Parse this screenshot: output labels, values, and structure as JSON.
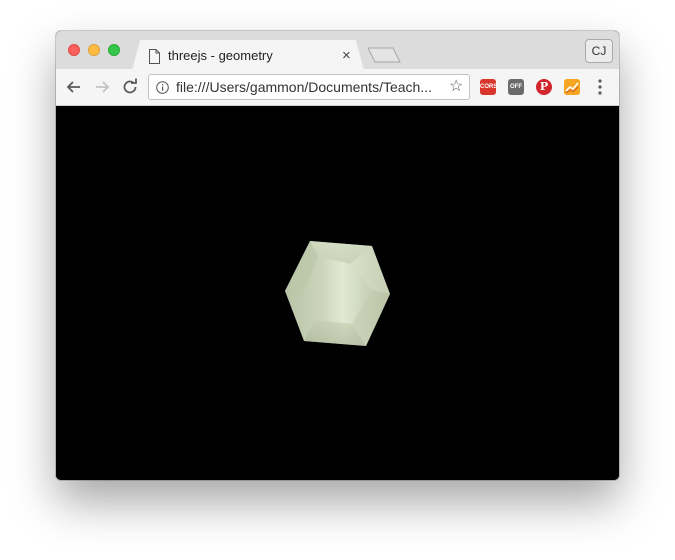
{
  "window": {
    "tab_title": "threejs - geometry",
    "tab_close_glyph": "×",
    "profile_label": "CJ"
  },
  "toolbar": {
    "url": "file:///Users/gammon/Documents/Teach...",
    "star_glyph": "☆",
    "extensions": [
      {
        "name": "cors-extension-icon",
        "label": "CORS"
      },
      {
        "name": "off-extension-icon",
        "label": "OFF"
      },
      {
        "name": "pinterest-extension-icon",
        "label": "P"
      },
      {
        "name": "analytics-extension-icon",
        "label": ""
      }
    ]
  },
  "scene": {
    "background": "#000000",
    "object": "hexagonal-prism-geometry",
    "object_color": "#d2dcc0"
  },
  "icons": {
    "back": "arrow-left-icon",
    "forward": "arrow-right-icon",
    "reload": "reload-icon",
    "info": "info-icon",
    "menu": "more-vert-icon"
  }
}
